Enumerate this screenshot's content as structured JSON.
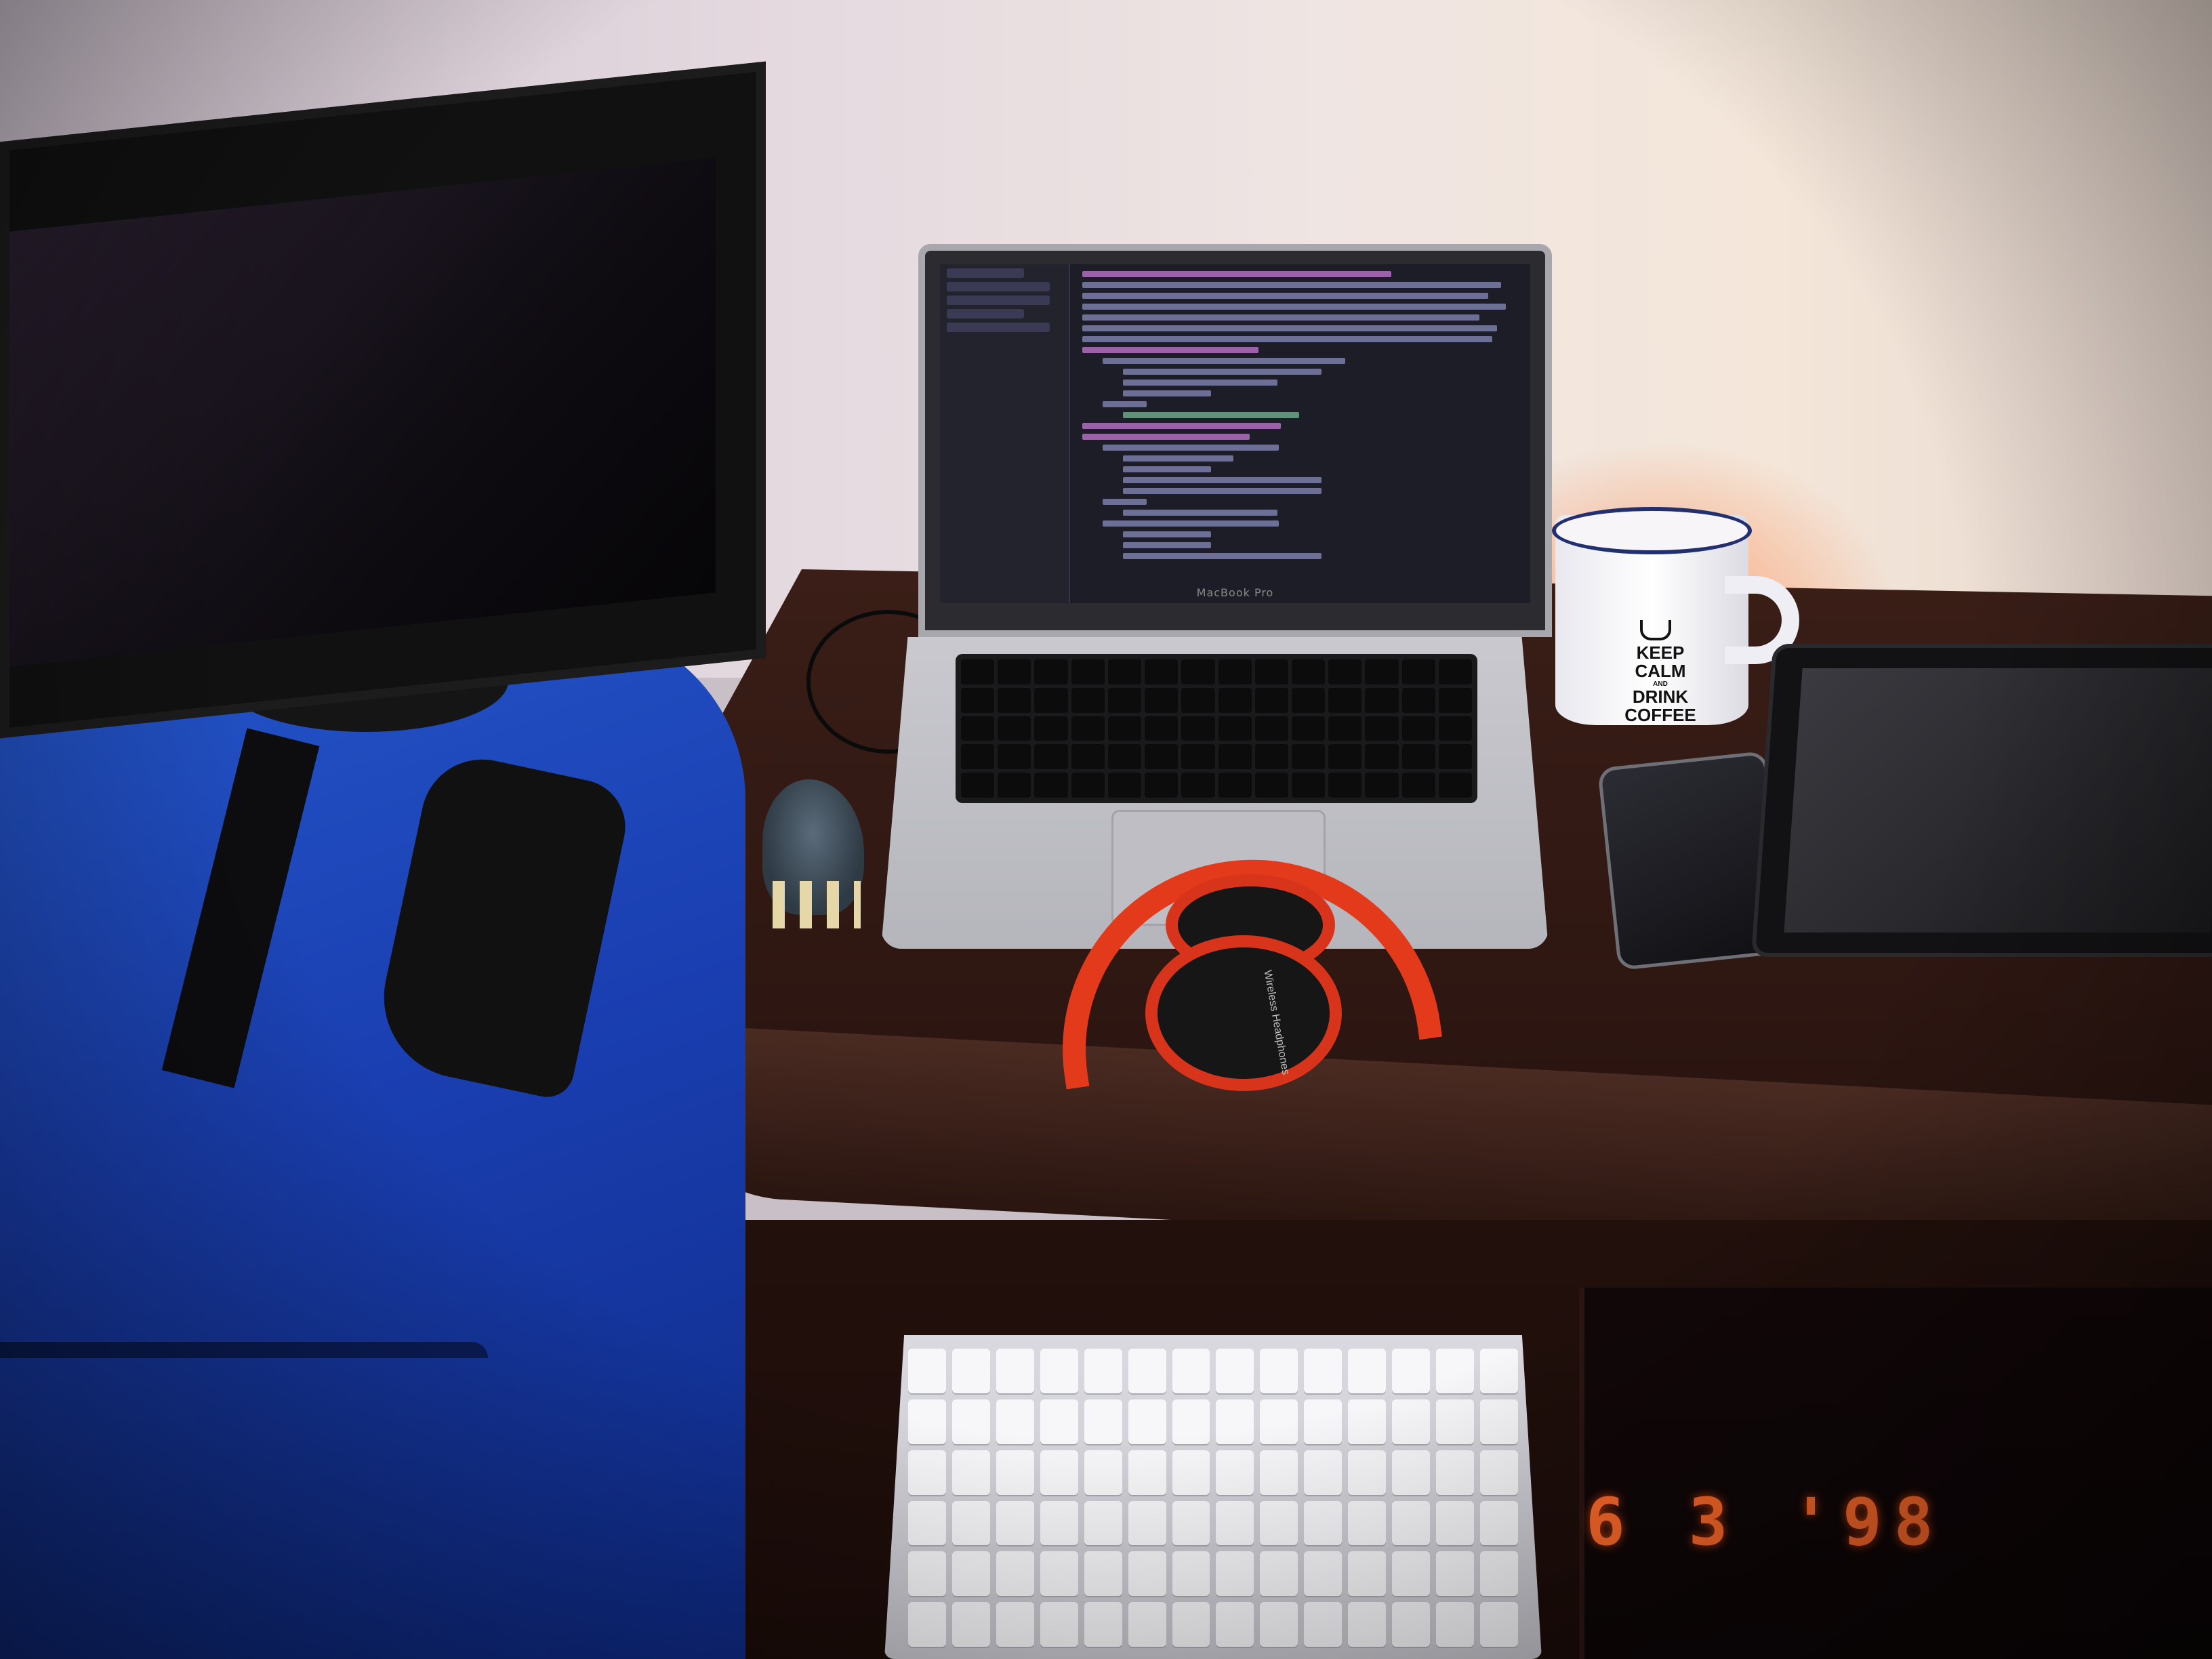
{
  "laptop": {
    "brand": "MacBook Pro"
  },
  "mug": {
    "line1": "KEEP",
    "line2": "CALM",
    "line3": "AND",
    "line4": "DRINK",
    "line5": "COFFEE"
  },
  "headphones": {
    "print": "Wireless Headphones"
  },
  "date_stamp": {
    "text": "6 3 '98"
  },
  "colors": {
    "date_stamp": "#ff6a2a",
    "headphone_accent": "#e23a1a",
    "case_blue": "#1a3fb2",
    "desk_wood": "#2f1712"
  }
}
